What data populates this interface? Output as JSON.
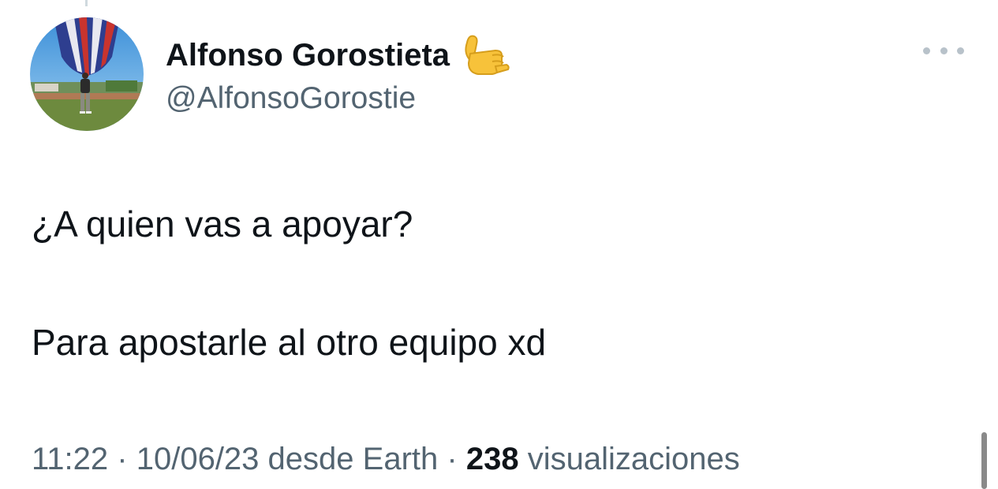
{
  "tweet": {
    "author": {
      "display_name": "Alfonso Gorostieta",
      "handle": "@AlfonsoGorostie",
      "avatar_icon": "avatar-hot-air-balloon-photo",
      "name_emoji_icon": "call-me-hand-emoji"
    },
    "more_options_icon": "more-horizontal-icon",
    "text_lines": [
      "¿A quien vas a apoyar?",
      "Para apostarle al otro equipo xd"
    ],
    "meta": {
      "time": "11:22",
      "separator": "·",
      "date": "10/06/23",
      "source": "desde Earth",
      "views_count": "238",
      "views_label": "visualizaciones"
    }
  },
  "colors": {
    "text_primary": "#0f1419",
    "text_secondary": "#536471",
    "background": "#ffffff",
    "emoji_yellow": "#f7c23a"
  }
}
